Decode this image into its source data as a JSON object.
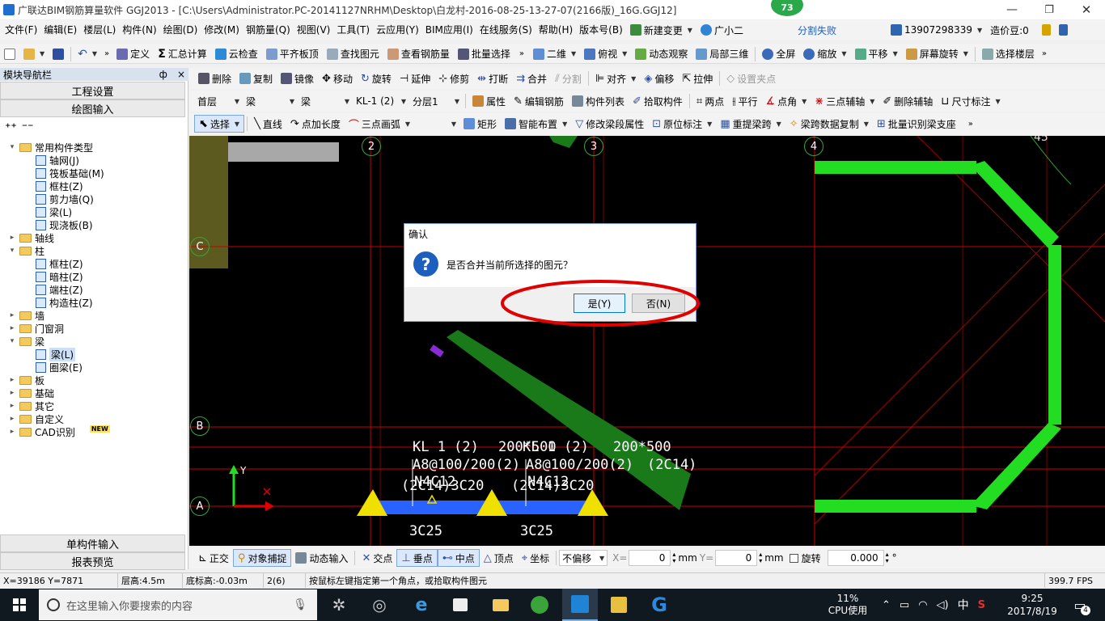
{
  "title_bar": {
    "title": "广联达BIM钢筋算量软件 GGJ2013 - [C:\\Users\\Administrator.PC-20141127NRHM\\Desktop\\白龙村-2016-08-25-13-27-07(2166版)_16G.GGJ12]",
    "badge": "73",
    "buttons": [
      "minimize",
      "maximize",
      "close"
    ]
  },
  "menu": {
    "items": [
      "文件(F)",
      "编辑(E)",
      "楼层(L)",
      "构件(N)",
      "绘图(D)",
      "修改(M)",
      "钢筋量(Q)",
      "视图(V)",
      "工具(T)",
      "云应用(Y)",
      "BIM应用(I)",
      "在线服务(S)",
      "帮助(H)",
      "版本号(B)"
    ],
    "change_label": "新建变更",
    "assistant_label": "广小二",
    "sync_status": "分割失败",
    "phone": "13907298339",
    "coins": "造价豆:0"
  },
  "toolbar1": {
    "items": [
      "定义",
      "汇总计算",
      "云检查",
      "平齐板顶",
      "查找图元",
      "查看钢筋量",
      "批量选择"
    ],
    "view_items": [
      "二维",
      "俯视",
      "动态观察",
      "局部三维",
      "全屏",
      "缩放",
      "平移",
      "屏幕旋转",
      "选择楼层"
    ]
  },
  "toolbar2": {
    "items": [
      "删除",
      "复制",
      "镜像",
      "移动",
      "旋转",
      "延伸",
      "修剪",
      "打断",
      "合并",
      "分割",
      "对齐",
      "偏移",
      "拉伸",
      "设置夹点"
    ]
  },
  "toolbar3": {
    "floor": "首层",
    "category": "梁",
    "type": "梁",
    "component": "KL-1 (2)",
    "layer": "分层1",
    "items": [
      "属性",
      "编辑钢筋",
      "构件列表",
      "拾取构件",
      "两点",
      "平行",
      "点角",
      "三点辅轴",
      "删除辅轴",
      "尺寸标注"
    ]
  },
  "toolbar4": {
    "items": [
      "选择",
      "直线",
      "点加长度",
      "三点画弧",
      "矩形",
      "智能布置",
      "修改梁段属性",
      "原位标注",
      "重提梁跨",
      "梁跨数据复制",
      "批量识别梁支座"
    ]
  },
  "panel": {
    "title": "模块导航栏",
    "pin": "ф",
    "close": "×",
    "project_settings": "工程设置",
    "drawing_input": "绘图输入",
    "single_input": "单构件输入",
    "report_preview": "报表预览",
    "tree": [
      {
        "label": "常用构件类型",
        "level": 0,
        "kind": "folder",
        "exp": "⊟"
      },
      {
        "label": "轴网(J)",
        "level": 1,
        "kind": "leaf"
      },
      {
        "label": "筏板基础(M)",
        "level": 1,
        "kind": "leaf"
      },
      {
        "label": "框柱(Z)",
        "level": 1,
        "kind": "leaf"
      },
      {
        "label": "剪力墙(Q)",
        "level": 1,
        "kind": "leaf"
      },
      {
        "label": "梁(L)",
        "level": 1,
        "kind": "leaf"
      },
      {
        "label": "现浇板(B)",
        "level": 1,
        "kind": "leaf"
      },
      {
        "label": "轴线",
        "level": 0,
        "kind": "folder",
        "exp": "⊞"
      },
      {
        "label": "柱",
        "level": 0,
        "kind": "folder",
        "exp": "⊟"
      },
      {
        "label": "框柱(Z)",
        "level": 1,
        "kind": "leaf"
      },
      {
        "label": "暗柱(Z)",
        "level": 1,
        "kind": "leaf"
      },
      {
        "label": "端柱(Z)",
        "level": 1,
        "kind": "leaf"
      },
      {
        "label": "构造柱(Z)",
        "level": 1,
        "kind": "leaf"
      },
      {
        "label": "墙",
        "level": 0,
        "kind": "folder",
        "exp": "⊞"
      },
      {
        "label": "门窗洞",
        "level": 0,
        "kind": "folder",
        "exp": "⊞"
      },
      {
        "label": "梁",
        "level": 0,
        "kind": "folder",
        "exp": "⊟"
      },
      {
        "label": "梁(L)",
        "level": 1,
        "kind": "leaf",
        "selected": true
      },
      {
        "label": "圈梁(E)",
        "level": 1,
        "kind": "leaf"
      },
      {
        "label": "板",
        "level": 0,
        "kind": "folder",
        "exp": "⊞"
      },
      {
        "label": "基础",
        "level": 0,
        "kind": "folder",
        "exp": "⊞"
      },
      {
        "label": "其它",
        "level": 0,
        "kind": "folder",
        "exp": "⊞"
      },
      {
        "label": "自定义",
        "level": 0,
        "kind": "folder",
        "exp": "⊞"
      },
      {
        "label": "CAD识别",
        "level": 0,
        "kind": "folder",
        "exp": "⊞"
      }
    ],
    "new_badge": "NEW"
  },
  "canvas": {
    "axis_labels_top": [
      "2",
      "3",
      "4"
    ],
    "axis_labels_left": [
      "C",
      "B",
      "A"
    ],
    "angle_label": "45",
    "annotations": {
      "beam1_name": "KL 1 (2)",
      "beam1_size": "200*500",
      "beam1_stirrup": "A8@100/200(2)",
      "beam1_top": "N4C12",
      "beam1_top2": "(2C14)3C20",
      "beam1_bottom": "3C25",
      "beam2_name": "KL 1 (2)",
      "beam2_size": "200*500",
      "beam2_stirrup": "A8@100/200(2)",
      "beam2_top": "N4C12",
      "beam2_top2": "(2C14)3C20",
      "beam2_bottom": "3C25",
      "overlap_1": "(2C14)",
      "overlap_2": "(2C14)"
    },
    "ucs_y": "Y"
  },
  "dialog": {
    "title": "确认",
    "message": "是否合并当前所选择的图元？",
    "yes": "是(Y)",
    "no": "否(N)",
    "icon": "question-icon"
  },
  "snap_bar": {
    "items": [
      "正交",
      "对象捕捉",
      "动态输入",
      "交点",
      "垂点",
      "中点",
      "顶点",
      "坐标"
    ],
    "offset_mode": "不偏移",
    "x_label": "X=",
    "x_value": "0",
    "x_unit": "mm",
    "y_label": "Y=",
    "y_value": "0",
    "y_unit": "mm",
    "rotate_label": "旋转",
    "rotate_value": "0.000",
    "rotate_unit": "°"
  },
  "status_bar": {
    "coords": "X=39186 Y=7871",
    "floor_height": "层高:4.5m",
    "base_height": "底标高:-0.03m",
    "count": "2(6)",
    "hint": "按鼠标左键指定第一个角点，或拾取构件图元",
    "fps": "399.7 FPS"
  },
  "taskbar": {
    "search_placeholder": "在这里输入你要搜索的内容",
    "cpu_percent": "11%",
    "cpu_label": "CPU使用",
    "ime": "中",
    "time": "9:25",
    "date": "2017/8/19",
    "notifications": "4"
  },
  "colors": {
    "canvas_bg": "#000000",
    "grid_red": "#c80000",
    "beam_green": "#1a7a1a",
    "wall_green": "#22dd22",
    "highlight": "#e00000",
    "support_yellow": "#f0e000",
    "beam_blue": "#2962ff"
  }
}
